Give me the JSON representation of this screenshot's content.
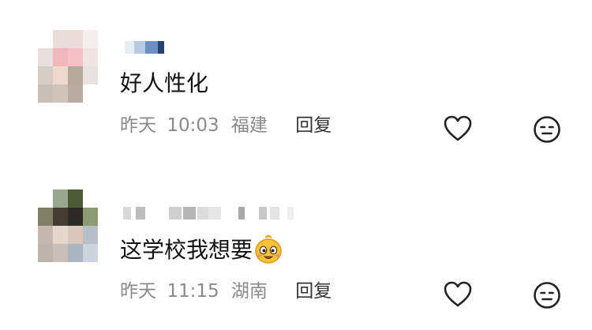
{
  "comments": [
    {
      "text": "好人性化",
      "date": "昨天",
      "time": "10:03",
      "location": "福建",
      "reply_label": "回复",
      "icons": [
        "avatar-blurred",
        "heart-icon",
        "neutral-face-icon"
      ]
    },
    {
      "text": "这学校我想要",
      "emoji": "grinning-emoji",
      "date": "昨天",
      "time": "11:15",
      "location": "湖南",
      "reply_label": "回复",
      "icons": [
        "avatar-blurred",
        "heart-icon",
        "neutral-face-icon"
      ]
    }
  ],
  "colors": {
    "text": "#121212",
    "meta": "#8a8a8a",
    "reply": "#333333",
    "icon_stroke": "#222222"
  }
}
